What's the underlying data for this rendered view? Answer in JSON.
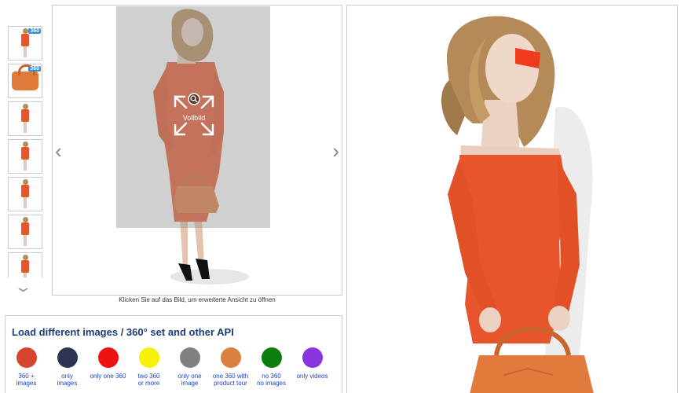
{
  "viewer": {
    "prev_arrow": "‹",
    "next_arrow": "›",
    "zoom_label": "Vollbild",
    "caption": "Klicken Sie auf das Bild, um erweiterte Ansicht zu öffnen"
  },
  "thumbs": {
    "badge_360": "360",
    "items": [
      "model-360",
      "bag-360",
      "model-front",
      "model-side",
      "model-back",
      "model-walk",
      "model-detail"
    ],
    "scroll_down": "⌄"
  },
  "api": {
    "title": "Load different images / 360° set and other API",
    "options": [
      {
        "line1": "360 +",
        "line2": "images",
        "color": "#d64530"
      },
      {
        "line1": "only",
        "line2": "images",
        "color": "#2e3552"
      },
      {
        "line1": "only one 360",
        "line2": "",
        "color": "#f01212"
      },
      {
        "line1": "two 360",
        "line2": "or more",
        "color": "#f6f108"
      },
      {
        "line1": "only one",
        "line2": "image",
        "color": "#808080"
      },
      {
        "line1": "one 360 with",
        "line2": "product tour",
        "color": "#d9813e"
      },
      {
        "line1": "no 360",
        "line2": "no images",
        "color": "#0d7d10"
      },
      {
        "line1": "only videos",
        "line2": "",
        "color": "#8a34e0"
      }
    ]
  },
  "colors": {
    "dress": "#e8542b",
    "hair": "#b48b58",
    "bag": "#e17a3a",
    "border": "#cccccc",
    "title": "#1e3c7a",
    "link": "#1a3fcf"
  }
}
